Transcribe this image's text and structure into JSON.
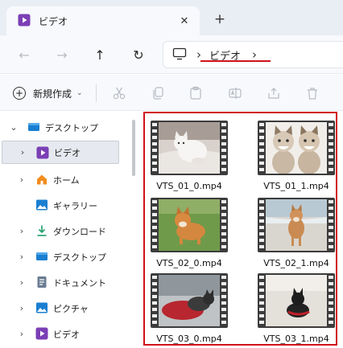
{
  "window": {
    "tab_title": "ビデオ",
    "close_glyph": "✕",
    "newtab_glyph": "+"
  },
  "nav": {
    "back_glyph": "←",
    "forward_glyph": "→",
    "up_glyph": "↑",
    "refresh_glyph": "↻"
  },
  "address": {
    "separator": "›",
    "crumbs": [
      "ビデオ"
    ],
    "trailing_separator": "›"
  },
  "commandbar": {
    "new_label": "新規作成",
    "new_dropdown_glyph": "⌄",
    "icons": [
      "cut-icon",
      "copy-icon",
      "paste-icon",
      "rename-icon",
      "share-icon",
      "delete-icon"
    ]
  },
  "sidebar": {
    "items": [
      {
        "label": "デスクトップ",
        "icon": "desktop-folder-icon",
        "expanded": true
      },
      {
        "label": "ビデオ",
        "icon": "videos-folder-icon",
        "selected": true
      },
      {
        "label": "ホーム",
        "icon": "home-icon"
      },
      {
        "label": "ギャラリー",
        "icon": "gallery-icon"
      },
      {
        "label": "ダウンロード",
        "icon": "download-icon"
      },
      {
        "label": "デスクトップ",
        "icon": "desktop-folder-icon"
      },
      {
        "label": "ドキュメント",
        "icon": "documents-icon"
      },
      {
        "label": "ピクチャ",
        "icon": "pictures-icon"
      },
      {
        "label": "ビデオ",
        "icon": "videos-folder-icon"
      }
    ]
  },
  "files": [
    {
      "name": "VTS_01_0.mp4",
      "thumbnail": "white-cat-in-bed"
    },
    {
      "name": "VTS_01_1.mp4",
      "thumbnail": "two-kittens"
    },
    {
      "name": "VTS_02_0.mp4",
      "thumbnail": "shiba-on-grass"
    },
    {
      "name": "VTS_02_1.mp4",
      "thumbnail": "shiba-on-beach"
    },
    {
      "name": "VTS_03_0.mp4",
      "thumbnail": "cat-on-red-cushion"
    },
    {
      "name": "VTS_03_1.mp4",
      "thumbnail": "black-cat-on-floor"
    }
  ],
  "colors": {
    "accent_red": "#d0121b",
    "video_icon": "#7b3fb5",
    "folder_blue": "#1a7fd1"
  }
}
